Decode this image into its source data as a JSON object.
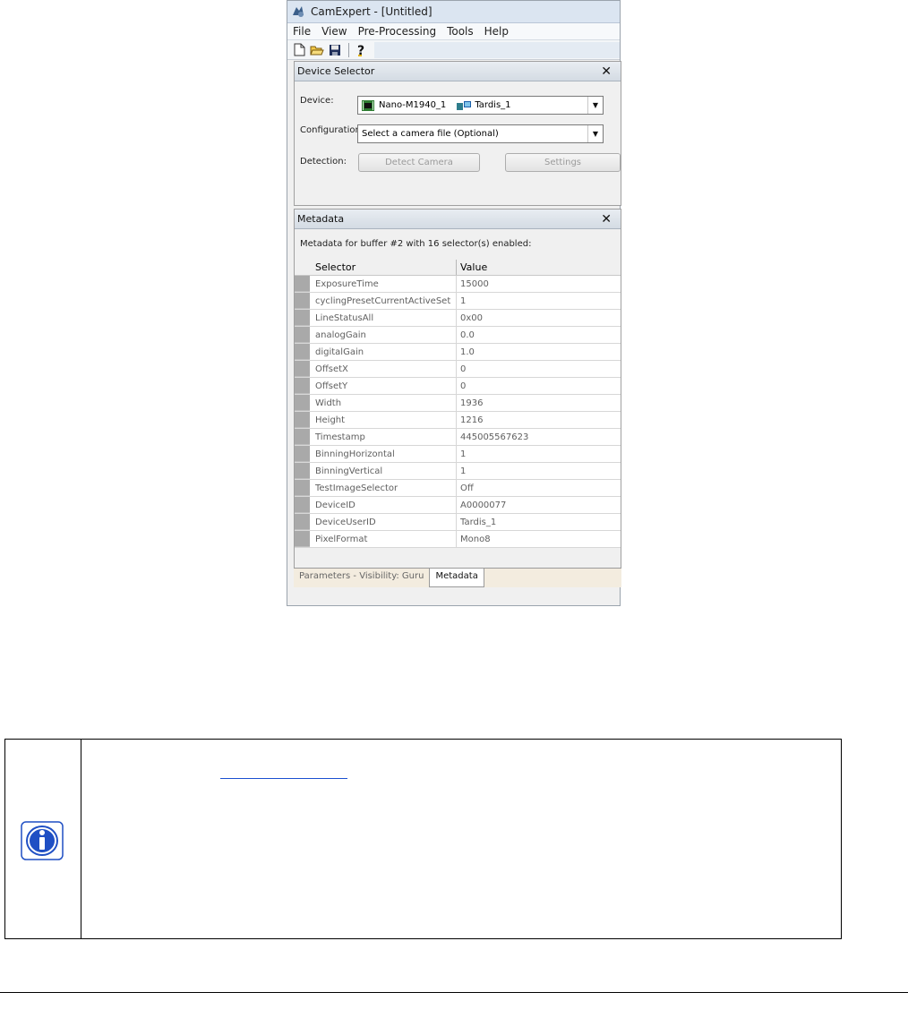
{
  "window": {
    "title": "CamExpert - [Untitled]",
    "menu": [
      "File",
      "View",
      "Pre-Processing",
      "Tools",
      "Help"
    ],
    "toolbar_icons": [
      "new-file-icon",
      "open-folder-icon",
      "save-icon",
      "help-icon"
    ]
  },
  "device_selector": {
    "header": "Device Selector",
    "device_label": "Device:",
    "device_value": "Nano-M1940_1",
    "device_server": "Tardis_1",
    "configuration_label": "Configuration:",
    "configuration_value": "Select a camera file (Optional)",
    "detection_label": "Detection:",
    "detect_button": "Detect Camera",
    "settings_button": "Settings"
  },
  "metadata": {
    "header": "Metadata",
    "caption": "Metadata for buffer #2 with 16 selector(s) enabled:",
    "columns": [
      "Selector",
      "Value"
    ],
    "rows": [
      [
        "ExposureTime",
        "15000"
      ],
      [
        "cyclingPresetCurrentActiveSet",
        "1"
      ],
      [
        "LineStatusAll",
        "0x00"
      ],
      [
        "analogGain",
        "0.0"
      ],
      [
        "digitalGain",
        "1.0"
      ],
      [
        "OffsetX",
        "0"
      ],
      [
        "OffsetY",
        "0"
      ],
      [
        "Width",
        "1936"
      ],
      [
        "Height",
        "1216"
      ],
      [
        "Timestamp",
        "445005567623"
      ],
      [
        "BinningHorizontal",
        "1"
      ],
      [
        "BinningVertical",
        "1"
      ],
      [
        "TestImageSelector",
        "Off"
      ],
      [
        "DeviceID",
        "A0000077"
      ],
      [
        "DeviceUserID",
        "Tardis_1"
      ],
      [
        "PixelFormat",
        "Mono8"
      ]
    ]
  },
  "tabs": [
    "Parameters - Visibility: Guru",
    "Metadata"
  ],
  "active_tab": "Metadata",
  "colors": {
    "title_bar": "#dbe5f1",
    "row_header": "#a9a9a9",
    "info_icon": "#1f4fc4"
  }
}
